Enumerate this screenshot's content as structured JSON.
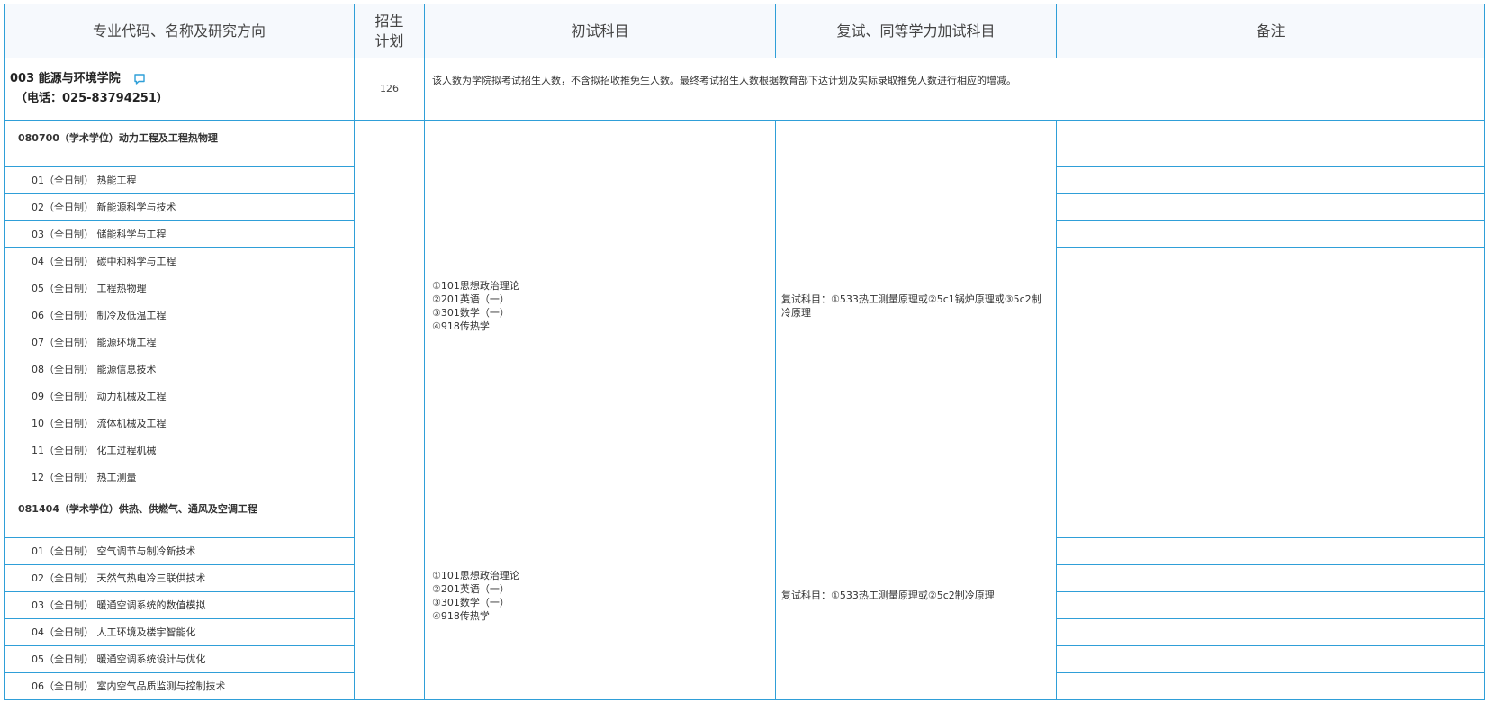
{
  "header": {
    "col1": "专业代码、名称及研究方向",
    "col2_line1": "招生",
    "col2_line2": "计划",
    "col3": "初试科目",
    "col4": "复试、同等学力加试科目",
    "col5": "备注"
  },
  "college": {
    "name": "003 能源与环境学院",
    "phone": "（电话：025-83794251）",
    "plan": "126",
    "note": "该人数为学院拟考试招生人数，不含拟招收推免生人数。最终考试招生人数根据教育部下达计划及实际录取推免人数进行相应的增减。",
    "chat_icon": "chat-bubble-icon",
    "accent_color": "#2f9fd8"
  },
  "majors": [
    {
      "title": "080700（学术学位）动力工程及工程热物理",
      "subjects": [
        "①101思想政治理论",
        "②201英语（一）",
        "③301数学（一）",
        "④918传热学"
      ],
      "retest": "复试科目：①533热工测量原理或②5c1锅炉原理或③5c2制冷原理",
      "directions": [
        "01（全日制） 热能工程",
        "02（全日制） 新能源科学与技术",
        "03（全日制） 储能科学与工程",
        "04（全日制） 碳中和科学与工程",
        "05（全日制） 工程热物理",
        "06（全日制） 制冷及低温工程",
        "07（全日制） 能源环境工程",
        "08（全日制） 能源信息技术",
        "09（全日制） 动力机械及工程",
        "10（全日制） 流体机械及工程",
        "11（全日制） 化工过程机械",
        "12（全日制） 热工测量"
      ]
    },
    {
      "title": "081404（学术学位）供热、供燃气、通风及空调工程",
      "subjects": [
        "①101思想政治理论",
        "②201英语（一）",
        "③301数学（一）",
        "④918传热学"
      ],
      "retest": "复试科目：①533热工测量原理或②5c2制冷原理",
      "directions": [
        "01（全日制） 空气调节与制冷新技术",
        "02（全日制） 天然气热电冷三联供技术",
        "03（全日制） 暖通空调系统的数值模拟",
        "04（全日制） 人工环境及楼宇智能化",
        "05（全日制） 暖通空调系统设计与优化",
        "06（全日制） 室内空气品质监测与控制技术"
      ]
    }
  ]
}
